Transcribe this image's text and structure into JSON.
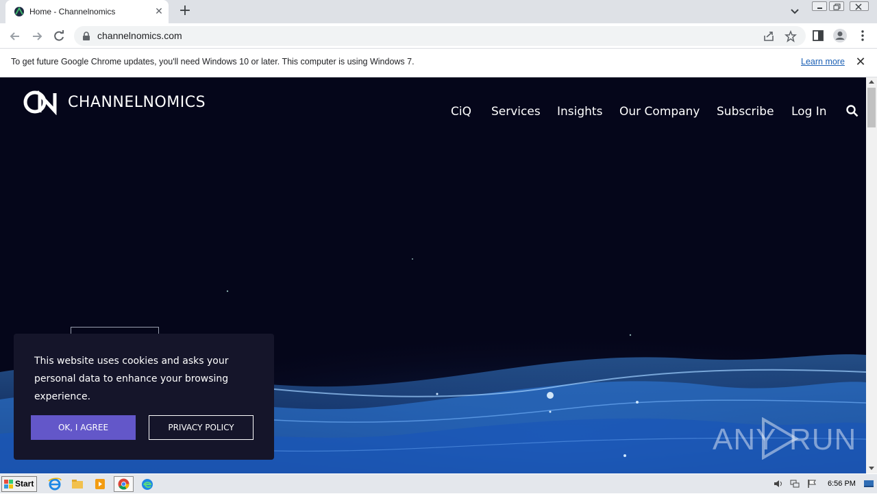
{
  "browser": {
    "tab_title": "Home - Channelnomics",
    "url": "channelnomics.com"
  },
  "infobar": {
    "message": "To get future Google Chrome updates, you'll need Windows 10 or later. This computer is using Windows 7.",
    "link": "Learn more"
  },
  "site": {
    "logo_text": "CHANNELNOMICS",
    "nav": [
      {
        "label": "CiQ"
      },
      {
        "label": "Services"
      },
      {
        "label": "Insights"
      },
      {
        "label": "Our Company"
      },
      {
        "label": "Subscribe"
      },
      {
        "label": "Log In"
      }
    ]
  },
  "cookie": {
    "message": "This website uses cookies and asks your personal data to enhance your browsing experience.",
    "agree": "OK, I AGREE",
    "privacy": "PRIVACY POLICY"
  },
  "watermark": {
    "left": "ANY",
    "right": "RUN"
  },
  "taskbar": {
    "start": "Start",
    "time": "6:56 PM"
  },
  "colors": {
    "page_bg": "#05061a",
    "agree_button": "#6357c9",
    "cookie_bg": "#15152a"
  }
}
